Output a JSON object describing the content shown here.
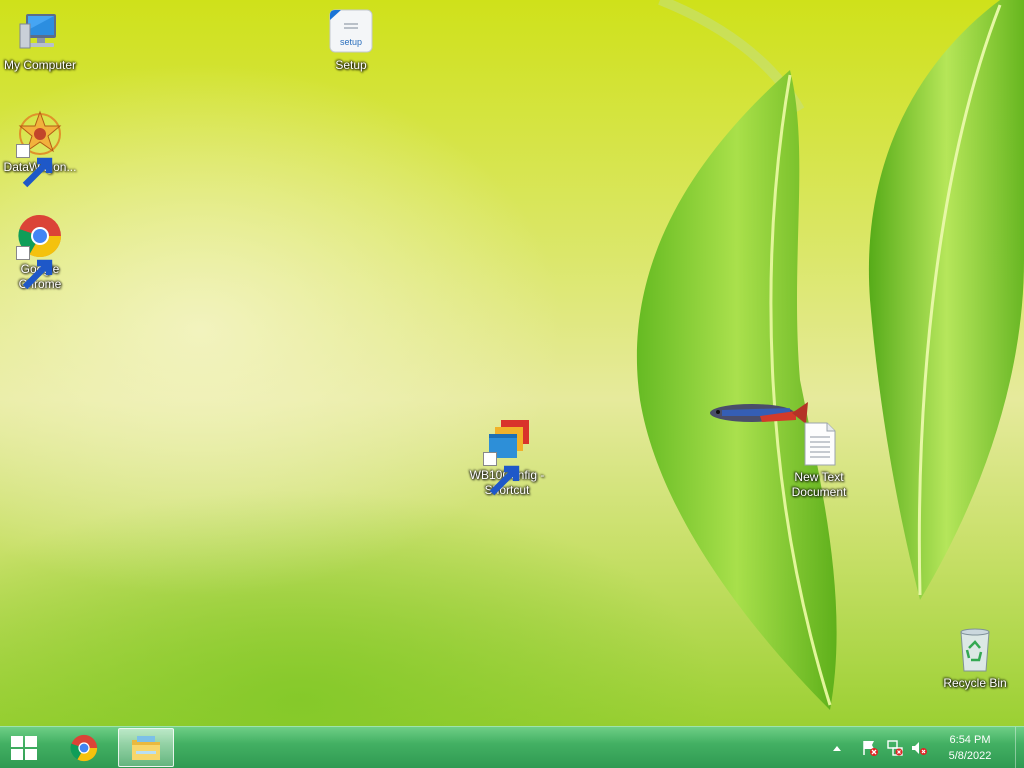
{
  "desktop": {
    "icons": {
      "my_computer": "My Computer",
      "setup": "Setup",
      "setup_image_text": "setup",
      "datawagon": "DataWagon...",
      "chrome_line1": "Google",
      "chrome_line2": "Chrome",
      "wb10_line1": "WB10Config -",
      "wb10_line2": "Shortcut",
      "text_doc_line1": "New Text",
      "text_doc_line2": "Document",
      "recycle_bin": "Recycle Bin"
    }
  },
  "taskbar": {
    "clock_time": "6:54 PM",
    "clock_date": "5/8/2022"
  },
  "colors": {
    "taskbar": "#3aa65b",
    "leaf": "#7fcf2a",
    "desktop_bg": "#d8e65a"
  }
}
